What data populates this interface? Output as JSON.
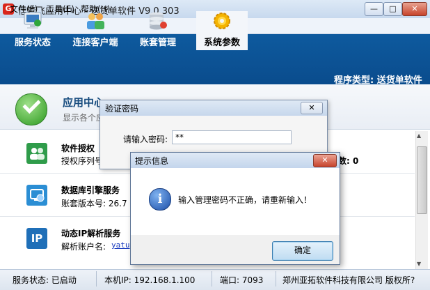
{
  "window": {
    "title": "信管飞应用中心 - 送货单软件 V9.0.303",
    "app_icon_glyph": "G"
  },
  "menu": {
    "file": "文件(F)",
    "tools": "工具(E)",
    "help": "帮助(H)"
  },
  "tabs": {
    "status": "服务状态",
    "connect": "连接客户端",
    "accounts": "账套管理",
    "system": "系统参数"
  },
  "program_type": "程序类型: 送货单软件",
  "header": {
    "title": "应用中心",
    "subtitle": "显示各个应"
  },
  "rows": {
    "license": {
      "title": "软件授权",
      "text": "授权序列号"
    },
    "database": {
      "title": "数据库引擎服务",
      "text": "账套版本号: 26.7"
    },
    "dynamic_ip": {
      "title": "动态IP解析服务",
      "text": "解析账户名:",
      "link": "yatu"
    }
  },
  "count_text": "数: 0",
  "status_bar": {
    "service": "服务状态: 已启动",
    "ip": "本机IP: 192.168.1.100",
    "port": "端口: 7093",
    "company": "郑州亚拓软件科技有限公司 版权所?"
  },
  "password_dialog": {
    "title": "验证密码",
    "label": "请输入密码:",
    "value": "**"
  },
  "info_dialog": {
    "title": "提示信息",
    "message": "输入管理密码不正确，请重新输入！",
    "ok_label": "确定",
    "icon_glyph": "i"
  },
  "colors": {
    "toolbar": "#0a4c8d",
    "accent": "#154a7d"
  }
}
